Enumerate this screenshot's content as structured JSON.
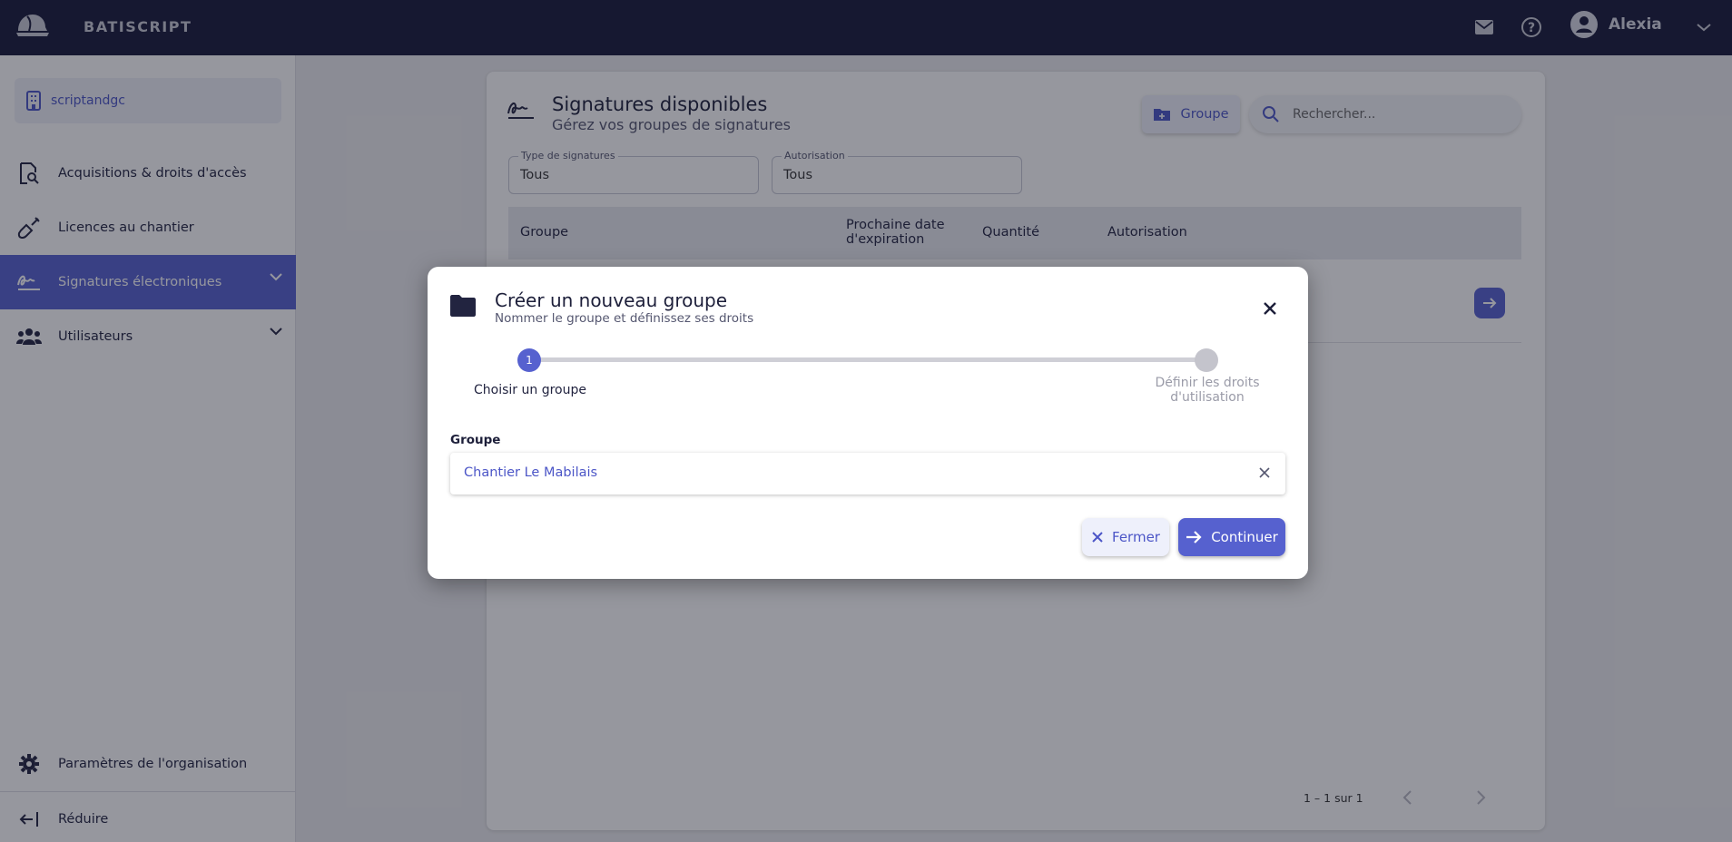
{
  "app": {
    "brand": "BATISCRIPT",
    "user_name": "Alexia"
  },
  "sidebar": {
    "org": "scriptandgc",
    "items": [
      {
        "label": "Acquisitions & droits d'accès",
        "icon": "document-key-icon"
      },
      {
        "label": "Licences au chantier",
        "icon": "shovel-icon"
      },
      {
        "label": "Signatures électroniques",
        "icon": "signature-icon",
        "active": true
      },
      {
        "label": "Utilisateurs",
        "icon": "users-icon"
      }
    ],
    "settings_label": "Paramètres de l'organisation",
    "collapse_label": "Réduire"
  },
  "main": {
    "title": "Signatures disponibles",
    "subtitle": "Gérez vos groupes de signatures",
    "group_button_label": "Groupe",
    "search_placeholder": "Rechercher...",
    "filters": [
      {
        "label": "Type de signatures",
        "value": "Tous"
      },
      {
        "label": "Autorisation",
        "value": "Tous"
      }
    ],
    "table": {
      "headers": [
        "Groupe",
        "Prochaine date\nd'expiration",
        "Quantité",
        "Autorisation"
      ]
    },
    "pagination": {
      "range_label": "1 – 1 sur 1"
    }
  },
  "modal": {
    "title": "Créer un nouveau groupe",
    "subtitle": "Nommer le groupe et définissez ses droits",
    "steps": [
      {
        "number": "1",
        "label": "Choisir un groupe"
      },
      {
        "label": "Définir les droits d'utilisation"
      }
    ],
    "field_label": "Groupe",
    "field_value": "Chantier Le Mabilais",
    "close_label": "Fermer",
    "continue_label": "Continuer"
  },
  "colors": {
    "primary": "#5661cf",
    "topbar": "#171939"
  }
}
